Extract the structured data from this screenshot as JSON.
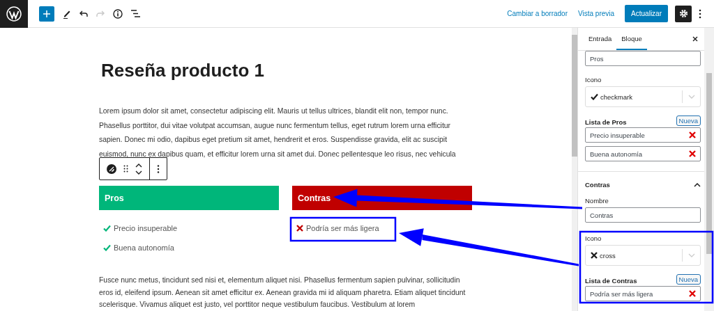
{
  "topbar": {
    "redo_disabled": true,
    "actions": [
      "Cambiar a borrador",
      "Vista previa"
    ],
    "primary_button": "Actualizar"
  },
  "editor": {
    "title": "Reseña producto 1",
    "paragraphs": [
      "Lorem ipsum dolor sit amet, consectetur adipiscing elit. Mauris ut tellus ultrices, blandit elit non, tempor nunc. Phasellus porttitor, dui vitae volutpat accumsan, augue nunc fermentum tellus, eget rutrum lorem urna efficitur sapien. Donec mi odio, dapibus eget pretium sit amet, hendrerit et eros. Suspendisse gravida, elit ac suscipit euismod, nunc ex dapibus quam, et efficitur lorem urna sit amet dui. Donec pellentesque leo risus, nec vehicula",
      "Fusce nunc metus, tincidunt sed nisi et, elementum aliquet nisi. Phasellus fermentum sapien pulvinar, sollicitudin eros id, eleifend ipsum. Aenean sit amet efficitur ex. Aenean gravida mi id aliquam pharetra. Etiam aliquet tincidunt scelerisque. Vivamus aliquet est justo, vel porttitor neque vestibulum faucibus. Vestibulum at lorem"
    ],
    "columns": [
      {
        "heading": "Pros",
        "color": "#00b67a",
        "kind": "check",
        "items": [
          "Precio insuperable",
          "Buena autonomía"
        ]
      },
      {
        "heading": "Contras",
        "color": "#c00000",
        "kind": "cross",
        "items": [
          "Podría ser más ligera"
        ]
      }
    ]
  },
  "sidebar": {
    "tabs": [
      {
        "label": "Entrada",
        "selected": false
      },
      {
        "label": "Bloque",
        "selected": true
      }
    ],
    "panels": [
      {
        "name_value": "Pros",
        "icon_label": "Icono",
        "kind": "check",
        "icon_value": "checkmark",
        "list_label": "Lista de Pros",
        "new_button": "Nueva",
        "items": [
          "Precio insuperable",
          "Buena autonomía"
        ]
      },
      {
        "title": "Contras",
        "expanded": true,
        "name_label": "Nombre",
        "name_value": "Contras",
        "icon_label": "Icono",
        "kind": "cross",
        "icon_value": "cross",
        "list_label": "Lista de Contras",
        "new_button": "Nueva",
        "items": [
          "Podría ser más ligera"
        ]
      }
    ]
  }
}
